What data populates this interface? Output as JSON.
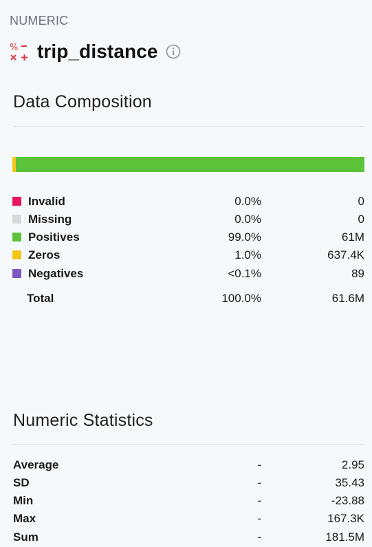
{
  "header": {
    "type_label": "NUMERIC",
    "field_name": "trip_distance",
    "type_icon": "numeric-type-icon",
    "info_icon": "info-icon"
  },
  "composition": {
    "title": "Data Composition",
    "bar_segments": [
      {
        "name": "Zeros",
        "fraction": 0.01,
        "color": "#f5c518"
      },
      {
        "name": "Positives",
        "fraction": 0.99,
        "color": "#5cc23a"
      }
    ],
    "rows": [
      {
        "label": "Invalid",
        "pct": "0.0%",
        "count": "0",
        "color": "#e8175d"
      },
      {
        "label": "Missing",
        "pct": "0.0%",
        "count": "0",
        "color": "#d9d9d9"
      },
      {
        "label": "Positives",
        "pct": "99.0%",
        "count": "61M",
        "color": "#5cc23a"
      },
      {
        "label": "Zeros",
        "pct": "1.0%",
        "count": "637.4K",
        "color": "#f5c518"
      },
      {
        "label": "Negatives",
        "pct": "<0.1%",
        "count": "89",
        "color": "#7e57c2"
      }
    ],
    "total": {
      "label": "Total",
      "pct": "100.0%",
      "count": "61.6M"
    }
  },
  "statistics": {
    "title": "Numeric Statistics",
    "rows": [
      {
        "label": "Average",
        "dash": "-",
        "value": "2.95"
      },
      {
        "label": "SD",
        "dash": "-",
        "value": "35.43"
      },
      {
        "label": "Min",
        "dash": "-",
        "value": "-23.88"
      },
      {
        "label": "Max",
        "dash": "-",
        "value": "167.3K"
      },
      {
        "label": "Sum",
        "dash": "-",
        "value": "181.5M"
      }
    ]
  }
}
